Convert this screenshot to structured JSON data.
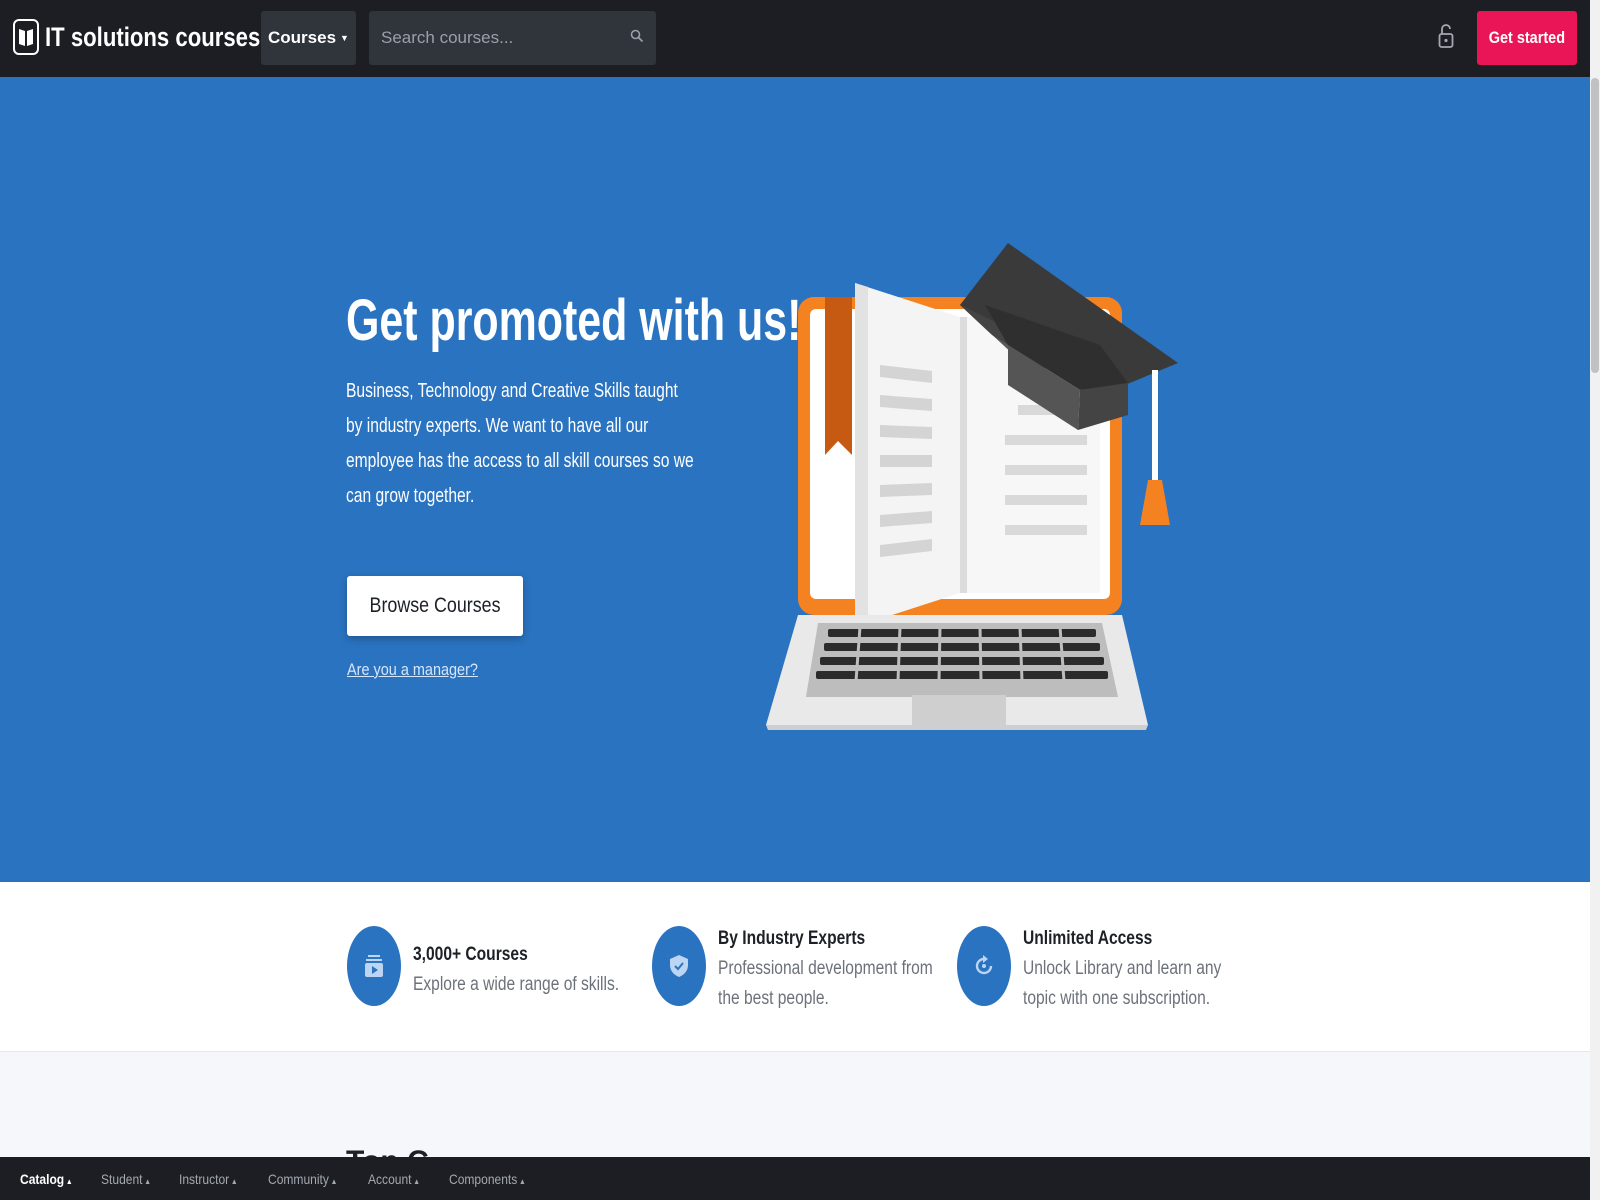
{
  "navbar": {
    "brand": "IT solutions courses",
    "courses_menu": "Courses",
    "search_placeholder": "Search courses...",
    "get_started": "Get started",
    "icons": [
      "book-logo-icon",
      "search-icon",
      "lock-icon"
    ]
  },
  "hero": {
    "title": "Get promoted with us!",
    "text": "Business, Technology and Creative Skills taught by industry experts. We want to have all our employee has the access to all skill courses so we can grow together.",
    "browse_button": "Browse Courses",
    "manager_link": "Are you a manager?",
    "background_color": "#2a73c0"
  },
  "features": [
    {
      "icon": "course-icon",
      "title": "3,000+ Courses",
      "desc": "Explore a wide range of skills."
    },
    {
      "icon": "shield-check-icon",
      "title": "By Industry Experts",
      "desc": "Professional development from the best people."
    },
    {
      "icon": "refresh-icon",
      "title": "Unlimited Access",
      "desc": "Unlock Library and learn any topic with one subscription."
    }
  ],
  "lower": {
    "heading": "Top C"
  },
  "bottom_bar": {
    "items": [
      "Catalog",
      "Student",
      "Instructor",
      "Community",
      "Account",
      "Components"
    ],
    "active": "Catalog"
  },
  "colors": {
    "accent": "#ea1556",
    "primary": "#2a73c0",
    "dark": "#1c1e23"
  }
}
